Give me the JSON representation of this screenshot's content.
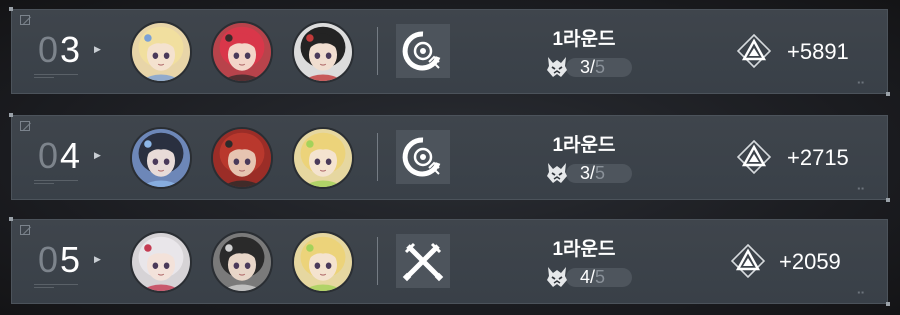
{
  "rows": [
    {
      "rank_prefix": "0",
      "rank_digit": "3",
      "round_label": "1라운드",
      "score_current": "3",
      "score_sep": "/",
      "score_max": "5",
      "reward": "+5891",
      "mode_icon": "target-swirl-up-icon",
      "avatars": [
        "elf-blonde-flower-crown-avatar",
        "red-hair-horns-avatar",
        "black-hair-white-cap-avatar"
      ]
    },
    {
      "rank_prefix": "0",
      "rank_digit": "4",
      "round_label": "1라운드",
      "score_current": "3",
      "score_sep": "/",
      "score_max": "5",
      "reward": "+2715",
      "mode_icon": "target-swirl-up-icon",
      "avatars": [
        "black-hair-blue-avatar",
        "red-hair-glasses-avatar",
        "blonde-green-ribbon-avatar"
      ]
    },
    {
      "rank_prefix": "0",
      "rank_digit": "5",
      "round_label": "1라운드",
      "score_current": "4",
      "score_sep": "/",
      "score_max": "5",
      "reward": "+2059",
      "mode_icon": "crossed-swords-icon",
      "avatars": [
        "silver-hair-avatar",
        "black-hair-boy-avatar",
        "blonde-green-ribbon-avatar"
      ]
    }
  ],
  "colors": {
    "panel": "#3f454c",
    "accent_dim": "#7d848c",
    "text": "#ffffff"
  }
}
